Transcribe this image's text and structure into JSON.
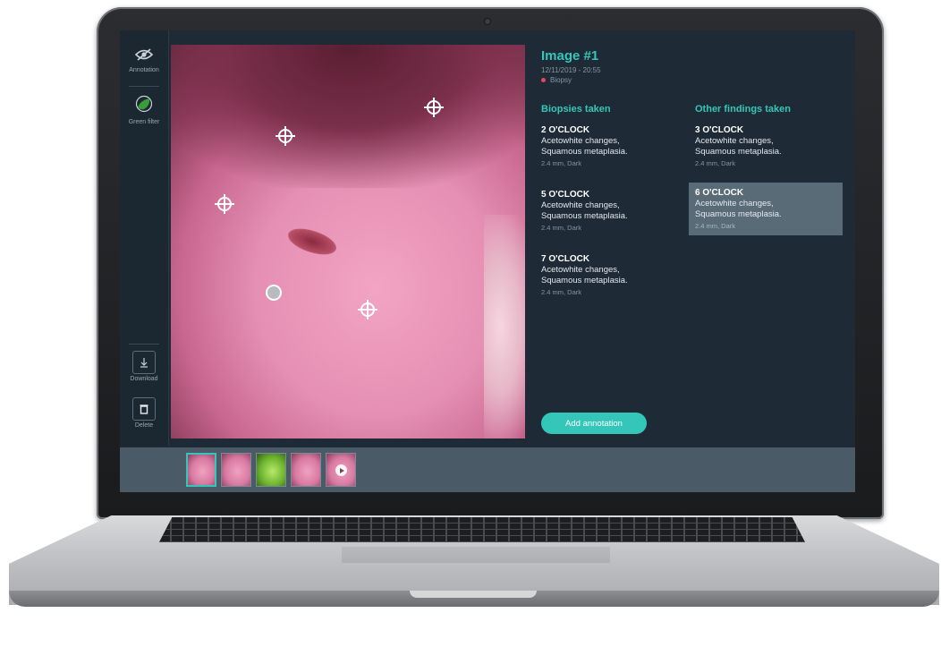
{
  "toolbar": {
    "annotation_label": "Annotation",
    "green_filter_label": "Green filter",
    "download_label": "Download",
    "delete_label": "Delete"
  },
  "image": {
    "title": "Image #1",
    "date": "12/11/2019 - 20:55",
    "legend_label": "Biopsy",
    "legend_color": "#e2475f"
  },
  "biopsies": {
    "heading": "Biopsies taken",
    "items": [
      {
        "time": "2 O'CLOCK",
        "line1": "Acetowhite changes,",
        "line2": "Squamous metaplasia.",
        "meta": "2.4 mm, Dark"
      },
      {
        "time": "5 O'CLOCK",
        "line1": "Acetowhite changes,",
        "line2": "Squamous metaplasia.",
        "meta": "2.4 mm, Dark"
      },
      {
        "time": "7 O'CLOCK",
        "line1": "Acetowhite changes,",
        "line2": "Squamous metaplasia.",
        "meta": "2.4 mm, Dark"
      }
    ]
  },
  "findings": {
    "heading": "Other findings taken",
    "items": [
      {
        "time": "3 O'CLOCK",
        "line1": "Acetowhite changes,",
        "line2": "Squamous metaplasia.",
        "meta": "2.4 mm, Dark",
        "selected": false
      },
      {
        "time": "6 O'CLOCK",
        "line1": "Acetowhite changes,",
        "line2": "Squamous metaplasia.",
        "meta": "2.4 mm, Dark",
        "selected": true
      }
    ]
  },
  "add_button_label": "Add annotation",
  "thumbnails": [
    {
      "kind": "image",
      "active": true
    },
    {
      "kind": "image",
      "active": false
    },
    {
      "kind": "green-filter",
      "active": false
    },
    {
      "kind": "image",
      "active": false
    },
    {
      "kind": "video",
      "active": false
    }
  ],
  "colors": {
    "accent": "#34c7b9",
    "screen_background": "#1e2b36",
    "selected_card": "#5a6b78",
    "thumbnail_strip": "#4a5a66"
  }
}
